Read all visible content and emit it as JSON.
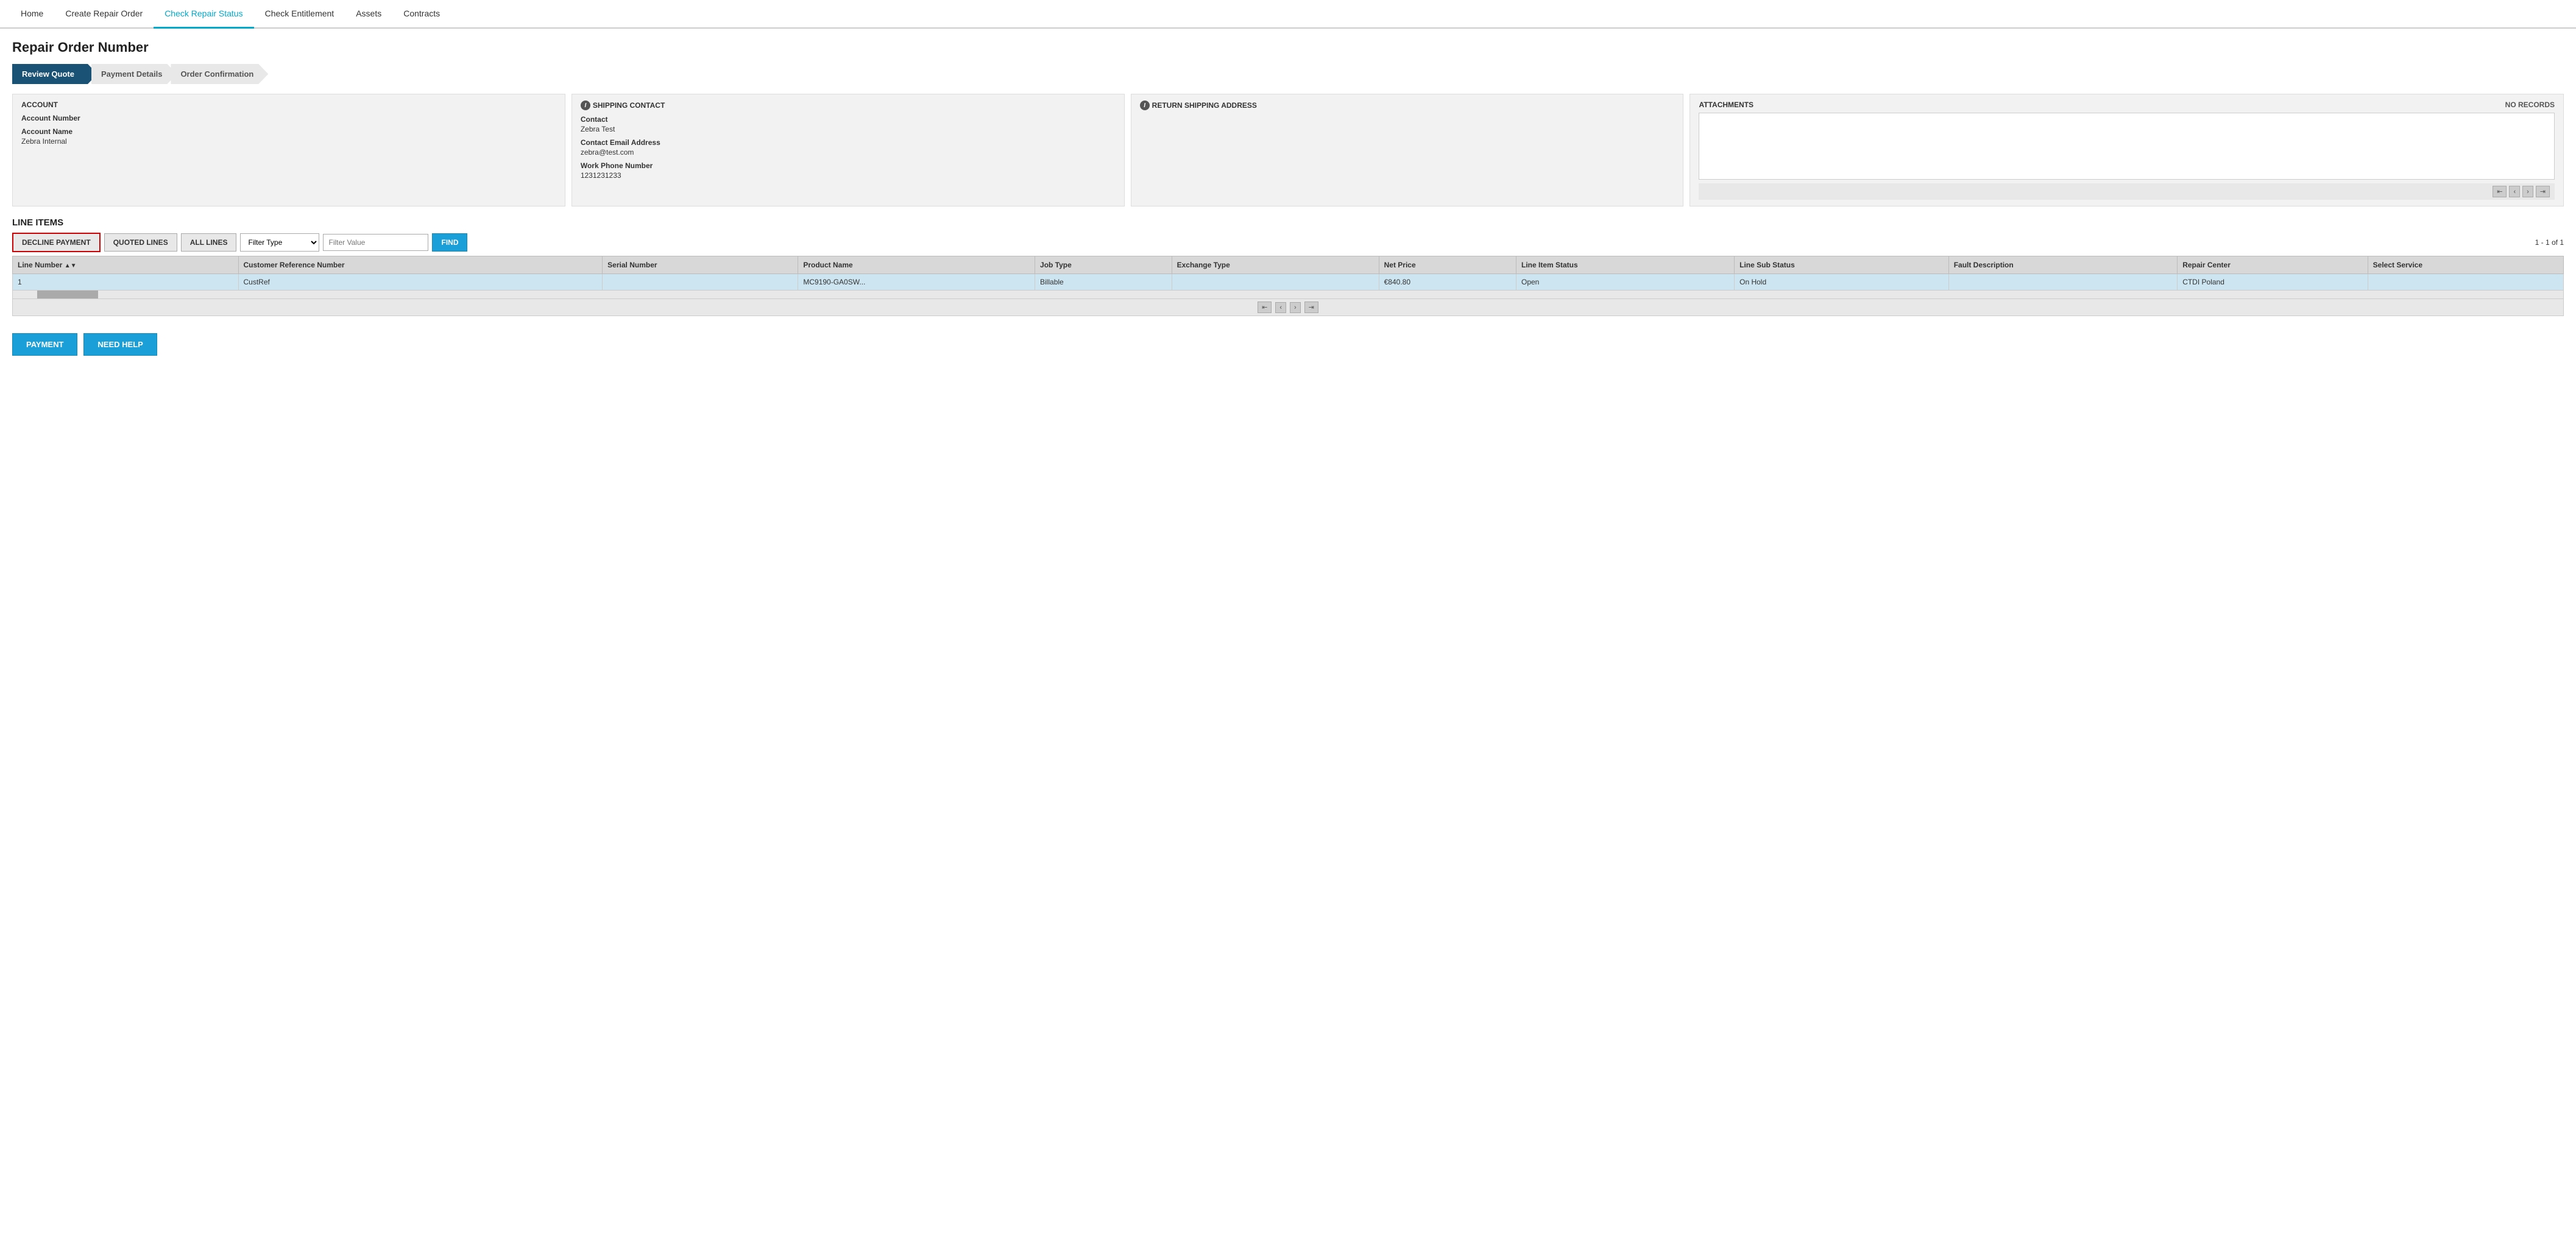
{
  "nav": {
    "items": [
      {
        "id": "home",
        "label": "Home",
        "active": false
      },
      {
        "id": "create-repair-order",
        "label": "Create Repair Order",
        "active": false
      },
      {
        "id": "check-repair-status",
        "label": "Check Repair Status",
        "active": true
      },
      {
        "id": "check-entitlement",
        "label": "Check Entitlement",
        "active": false
      },
      {
        "id": "assets",
        "label": "Assets",
        "active": false
      },
      {
        "id": "contracts",
        "label": "Contracts",
        "active": false
      }
    ]
  },
  "page": {
    "title": "Repair Order Number"
  },
  "wizard": {
    "steps": [
      {
        "id": "review-quote",
        "label": "Review Quote",
        "state": "active"
      },
      {
        "id": "payment-details",
        "label": "Payment Details",
        "state": "inactive"
      },
      {
        "id": "order-confirmation",
        "label": "Order Confirmation",
        "state": "inactive"
      }
    ]
  },
  "account_box": {
    "header": "ACCOUNT",
    "fields": [
      {
        "label": "Account Number",
        "value": ""
      },
      {
        "label": "Account Name",
        "value": "Zebra Internal"
      }
    ]
  },
  "shipping_contact_box": {
    "header": "SHIPPING CONTACT",
    "fields": [
      {
        "label": "Contact",
        "value": "Zebra Test"
      },
      {
        "label": "Contact Email Address",
        "value": "zebra@test.com"
      },
      {
        "label": "Work Phone Number",
        "value": "1231231233"
      }
    ]
  },
  "return_shipping_box": {
    "header": "RETURN SHIPPING ADDRESS",
    "fields": []
  },
  "attachments_box": {
    "header": "ATTACHMENTS",
    "no_records": "No Records"
  },
  "line_items": {
    "section_title": "LINE ITEMS",
    "pagination": "1 - 1 of 1",
    "buttons": {
      "decline": "DECLINE PAYMENT",
      "quoted_lines": "QUOTED LINES",
      "all_lines": "ALL LINES",
      "find": "FIND"
    },
    "filter_type_placeholder": "Filter Type",
    "filter_value_placeholder": "Filter Value",
    "columns": [
      {
        "id": "line-number",
        "label": "Line Number",
        "sortable": true
      },
      {
        "id": "customer-ref",
        "label": "Customer Reference Number"
      },
      {
        "id": "serial-number",
        "label": "Serial Number"
      },
      {
        "id": "product-name",
        "label": "Product Name"
      },
      {
        "id": "job-type",
        "label": "Job Type"
      },
      {
        "id": "exchange-type",
        "label": "Exchange Type"
      },
      {
        "id": "net-price",
        "label": "Net Price"
      },
      {
        "id": "line-item-status",
        "label": "Line Item Status"
      },
      {
        "id": "line-sub-status",
        "label": "Line Sub Status"
      },
      {
        "id": "fault-description",
        "label": "Fault Description"
      },
      {
        "id": "repair-center",
        "label": "Repair Center"
      },
      {
        "id": "select-service",
        "label": "Select Service"
      }
    ],
    "rows": [
      {
        "line_number": "1",
        "customer_ref": "CustRef",
        "serial_number": "",
        "product_name": "MC9190-GA0SW...",
        "job_type": "Billable",
        "exchange_type": "",
        "net_price": "€840.80",
        "line_item_status": "Open",
        "line_sub_status": "On Hold",
        "fault_description": "",
        "repair_center": "CTDI Poland",
        "select_service": ""
      }
    ]
  },
  "bottom_buttons": {
    "payment": "PAYMENT",
    "need_help": "NEED HELP"
  }
}
